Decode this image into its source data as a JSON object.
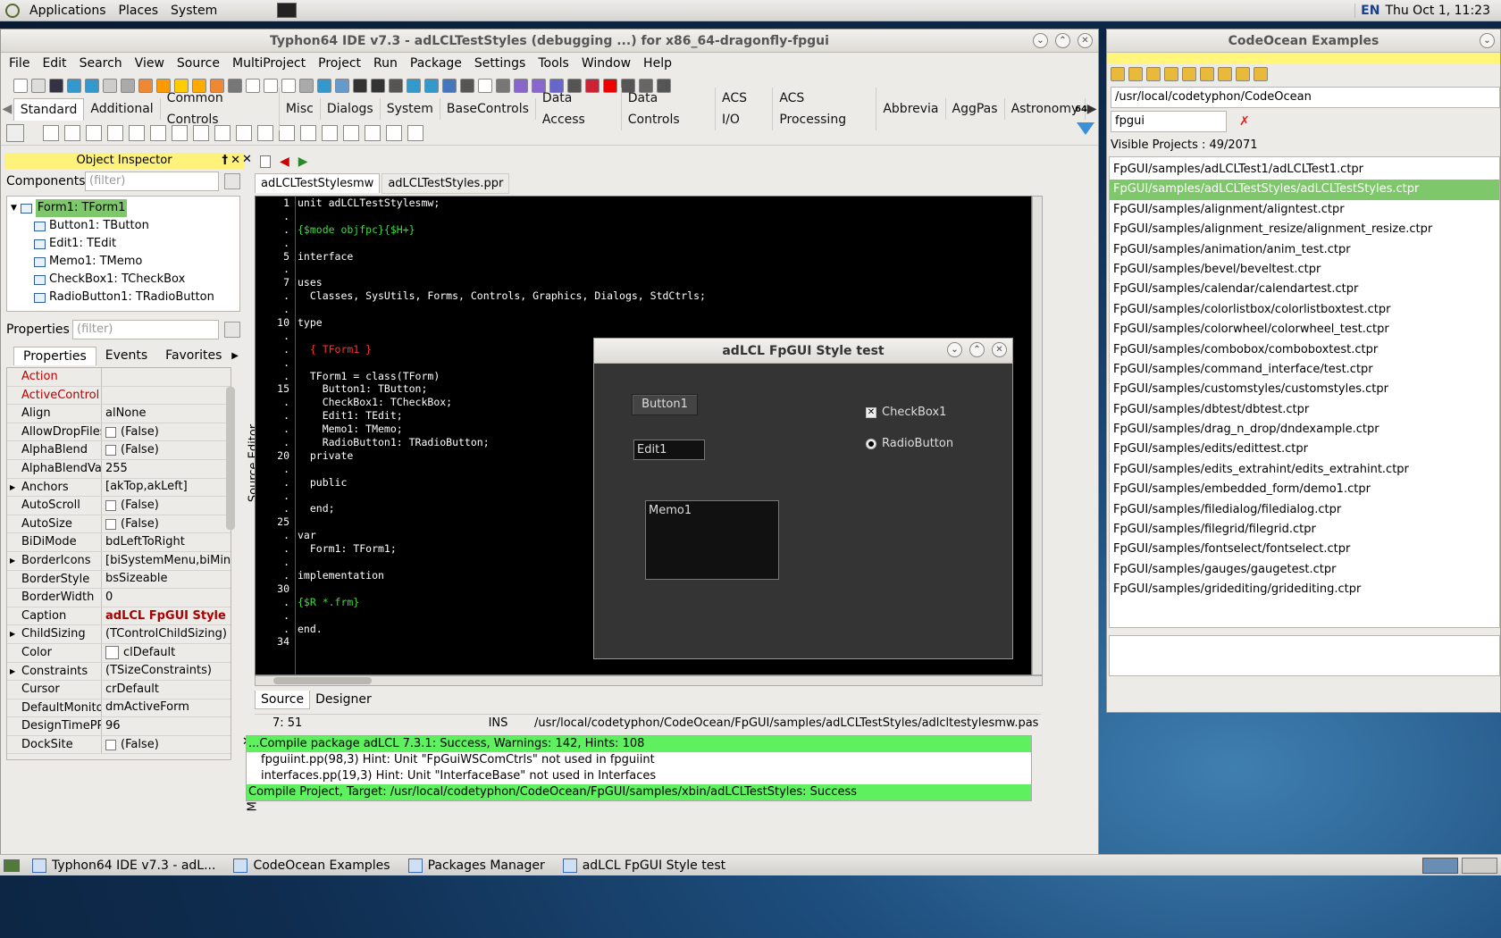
{
  "panel": {
    "applications": "Applications",
    "places": "Places",
    "system": "System",
    "lang": "EN",
    "datetime": "Thu Oct  1, 11:23"
  },
  "ide": {
    "title": "Typhon64 IDE v7.3 - adLCLTestStyles (debugging ...) for x86_64-dragonfly-fpgui",
    "menu": [
      "File",
      "Edit",
      "Search",
      "View",
      "Source",
      "MultiProject",
      "Project",
      "Run",
      "Package",
      "Settings",
      "Tools",
      "Window",
      "Help"
    ],
    "palette_tabs": [
      "Standard",
      "Additional",
      "Common Controls",
      "Misc",
      "Dialogs",
      "System",
      "BaseControls",
      "Data Access",
      "Data Controls",
      "ACS I/O",
      "ACS Processing",
      "Abbrevia",
      "AggPas",
      "Astronomy"
    ],
    "bits_label": "64"
  },
  "oi": {
    "title": "Object Inspector",
    "components_label": "Components",
    "filter_placeholder": "(filter)",
    "tree": [
      "Form1: TForm1",
      "Button1: TButton",
      "Edit1: TEdit",
      "Memo1: TMemo",
      "CheckBox1: TCheckBox",
      "RadioButton1: TRadioButton"
    ],
    "properties_label": "Properties",
    "tabs": [
      "Properties",
      "Events",
      "Favorites"
    ],
    "props": [
      {
        "name": "Action",
        "value": ""
      },
      {
        "name": "ActiveControl",
        "value": ""
      },
      {
        "name": "Align",
        "value": "alNone"
      },
      {
        "name": "AllowDropFiles",
        "value": "(False)"
      },
      {
        "name": "AlphaBlend",
        "value": "(False)"
      },
      {
        "name": "AlphaBlendVal",
        "value": "255"
      },
      {
        "name": "Anchors",
        "value": "[akTop,akLeft]"
      },
      {
        "name": "AutoScroll",
        "value": "(False)"
      },
      {
        "name": "AutoSize",
        "value": "(False)"
      },
      {
        "name": "BiDiMode",
        "value": "bdLeftToRight"
      },
      {
        "name": "BorderIcons",
        "value": "[biSystemMenu,biMin"
      },
      {
        "name": "BorderStyle",
        "value": "bsSizeable"
      },
      {
        "name": "BorderWidth",
        "value": "0"
      },
      {
        "name": "Caption",
        "value": "adLCL FpGUI Style"
      },
      {
        "name": "ChildSizing",
        "value": "(TControlChildSizing)"
      },
      {
        "name": "Color",
        "value": "clDefault"
      },
      {
        "name": "Constraints",
        "value": "(TSizeConstraints)"
      },
      {
        "name": "Cursor",
        "value": "crDefault"
      },
      {
        "name": "DefaultMonito",
        "value": "dmActiveForm"
      },
      {
        "name": "DesignTimePP",
        "value": "96"
      },
      {
        "name": "DockSite",
        "value": "(False)"
      }
    ]
  },
  "editor": {
    "tabs": [
      "adLCLTestStylesmw",
      "adLCLTestStyles.ppr"
    ],
    "side_label": "Source Editor",
    "lines": [
      {
        "n": "1",
        "t": "unit adLCLTestStylesmw;",
        "c": "#ffffff"
      },
      {
        "n": ".",
        "t": "",
        "c": "#ffffff"
      },
      {
        "n": ".",
        "t": "{$mode objfpc}{$H+}",
        "c": "#3ddc3d"
      },
      {
        "n": ".",
        "t": "",
        "c": "#ffffff"
      },
      {
        "n": "5",
        "t": "interface",
        "c": "#ffffff"
      },
      {
        "n": ".",
        "t": "",
        "c": "#ffffff"
      },
      {
        "n": "7",
        "t": "uses",
        "c": "#ffffff"
      },
      {
        "n": ".",
        "t": "  Classes, SysUtils, Forms, Controls, Graphics, Dialogs, StdCtrls;",
        "c": "#ffffff"
      },
      {
        "n": ".",
        "t": "",
        "c": "#ffffff"
      },
      {
        "n": "10",
        "t": "type",
        "c": "#ffffff"
      },
      {
        "n": ".",
        "t": "",
        "c": "#ffffff"
      },
      {
        "n": ".",
        "t": "  { TForm1 }",
        "c": "#ff3030"
      },
      {
        "n": ".",
        "t": "",
        "c": "#ffffff"
      },
      {
        "n": ".",
        "t": "  TForm1 = class(TForm)",
        "c": "#ffffff"
      },
      {
        "n": "15",
        "t": "    Button1: TButton;",
        "c": "#ffffff"
      },
      {
        "n": ".",
        "t": "    CheckBox1: TCheckBox;",
        "c": "#ffffff"
      },
      {
        "n": ".",
        "t": "    Edit1: TEdit;",
        "c": "#ffffff"
      },
      {
        "n": ".",
        "t": "    Memo1: TMemo;",
        "c": "#ffffff"
      },
      {
        "n": ".",
        "t": "    RadioButton1: TRadioButton;",
        "c": "#ffffff"
      },
      {
        "n": "20",
        "t": "  private",
        "c": "#ffffff"
      },
      {
        "n": ".",
        "t": "",
        "c": "#ffffff"
      },
      {
        "n": ".",
        "t": "  public",
        "c": "#ffffff"
      },
      {
        "n": ".",
        "t": "",
        "c": "#ffffff"
      },
      {
        "n": ".",
        "t": "  end;",
        "c": "#ffffff"
      },
      {
        "n": "25",
        "t": "",
        "c": "#ffffff"
      },
      {
        "n": ".",
        "t": "var",
        "c": "#ffffff"
      },
      {
        "n": ".",
        "t": "  Form1: TForm1;",
        "c": "#ffffff"
      },
      {
        "n": ".",
        "t": "",
        "c": "#ffffff"
      },
      {
        "n": ".",
        "t": "implementation",
        "c": "#ffffff"
      },
      {
        "n": "30",
        "t": "",
        "c": "#ffffff"
      },
      {
        "n": ".",
        "t": "{$R *.frm}",
        "c": "#3ddc3d"
      },
      {
        "n": ".",
        "t": "",
        "c": "#ffffff"
      },
      {
        "n": ".",
        "t": "end.",
        "c": "#ffffff"
      },
      {
        "n": "34",
        "t": "",
        "c": "#ffffff"
      }
    ],
    "bottom_tabs": [
      "Source",
      "Designer"
    ],
    "status_pos": "7: 51",
    "status_mode": "INS",
    "status_path": "/usr/local/codetyphon/CodeOcean/FpGUI/samples/adLCLTestStyles/adlcltestylesmw.pas"
  },
  "messages": {
    "side_label": "Messages",
    "lines": [
      {
        "t": "...Compile package adLCL 7.3.1: Success, Warnings: 142, Hints: 108",
        "hl": true
      },
      {
        "t": "fpguiint.pp(98,3) Hint: Unit \"FpGuiWSComCtrls\" not used in fpguiint",
        "hl": false
      },
      {
        "t": "interfaces.pp(19,3) Hint: Unit \"InterfaceBase\" not used in Interfaces",
        "hl": false
      },
      {
        "t": "Compile Project, Target: /usr/local/codetyphon/CodeOcean/FpGUI/samples/xbin/adLCLTestStyles: Success",
        "hl": true
      }
    ]
  },
  "dialog": {
    "title": "adLCL FpGUI Style test",
    "button": "Button1",
    "edit": "Edit1",
    "memo": "Memo1",
    "checkbox": "CheckBox1",
    "radio": "RadioButton"
  },
  "codeocean": {
    "title": "CodeOcean Examples",
    "path": "/usr/local/codetyphon/CodeOcean",
    "search": "fpgui",
    "visible": "Visible Projects : 49/2071",
    "items": [
      "FpGUI/samples/adLCLTest1/adLCLTest1.ctpr",
      "FpGUI/samples/adLCLTestStyles/adLCLTestStyles.ctpr",
      "FpGUI/samples/alignment/aligntest.ctpr",
      "FpGUI/samples/alignment_resize/alignment_resize.ctpr",
      "FpGUI/samples/animation/anim_test.ctpr",
      "FpGUI/samples/bevel/beveltest.ctpr",
      "FpGUI/samples/calendar/calendartest.ctpr",
      "FpGUI/samples/colorlistbox/colorlistboxtest.ctpr",
      "FpGUI/samples/colorwheel/colorwheel_test.ctpr",
      "FpGUI/samples/combobox/comboboxtest.ctpr",
      "FpGUI/samples/command_interface/test.ctpr",
      "FpGUI/samples/customstyles/customstyles.ctpr",
      "FpGUI/samples/dbtest/dbtest.ctpr",
      "FpGUI/samples/drag_n_drop/dndexample.ctpr",
      "FpGUI/samples/edits/edittest.ctpr",
      "FpGUI/samples/edits_extrahint/edits_extrahint.ctpr",
      "FpGUI/samples/embedded_form/demo1.ctpr",
      "FpGUI/samples/filedialog/filedialog.ctpr",
      "FpGUI/samples/filegrid/filegrid.ctpr",
      "FpGUI/samples/fontselect/fontselect.ctpr",
      "FpGUI/samples/gauges/gaugetest.ctpr",
      "FpGUI/samples/gridediting/gridediting.ctpr"
    ],
    "selected_index": 1
  },
  "taskbar": [
    "Typhon64 IDE v7.3 - adL...",
    "CodeOcean Examples",
    "Packages Manager",
    "adLCL FpGUI Style test"
  ]
}
